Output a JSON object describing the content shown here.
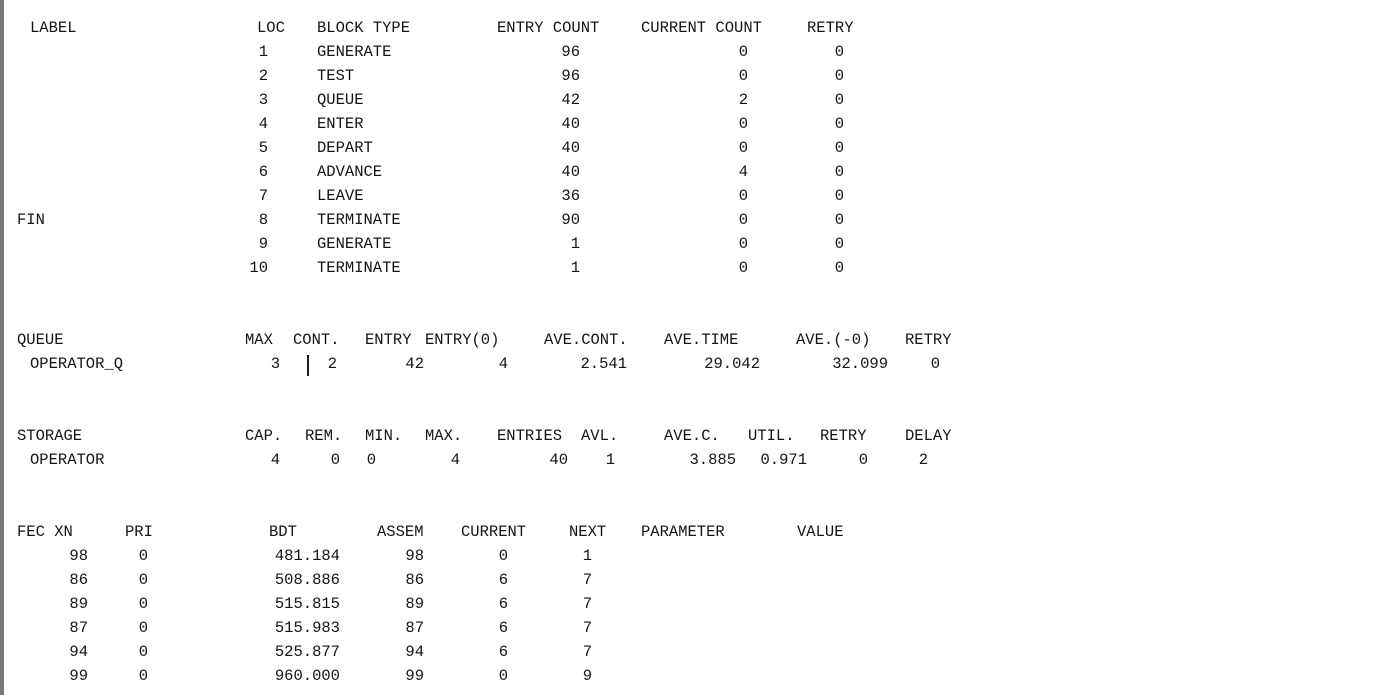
{
  "blocks": {
    "headers": {
      "label": "LABEL",
      "loc": "LOC",
      "block_type": "BLOCK TYPE",
      "entry_count": "ENTRY COUNT",
      "current_count": "CURRENT COUNT",
      "retry": "RETRY"
    },
    "rows": [
      {
        "label": "",
        "loc": "1",
        "block_type": "GENERATE",
        "entry_count": "96",
        "current_count": "0",
        "retry": "0"
      },
      {
        "label": "",
        "loc": "2",
        "block_type": "TEST",
        "entry_count": "96",
        "current_count": "0",
        "retry": "0"
      },
      {
        "label": "",
        "loc": "3",
        "block_type": "QUEUE",
        "entry_count": "42",
        "current_count": "2",
        "retry": "0"
      },
      {
        "label": "",
        "loc": "4",
        "block_type": "ENTER",
        "entry_count": "40",
        "current_count": "0",
        "retry": "0"
      },
      {
        "label": "",
        "loc": "5",
        "block_type": "DEPART",
        "entry_count": "40",
        "current_count": "0",
        "retry": "0"
      },
      {
        "label": "",
        "loc": "6",
        "block_type": "ADVANCE",
        "entry_count": "40",
        "current_count": "4",
        "retry": "0"
      },
      {
        "label": "",
        "loc": "7",
        "block_type": "LEAVE",
        "entry_count": "36",
        "current_count": "0",
        "retry": "0"
      },
      {
        "label": "FIN",
        "loc": "8",
        "block_type": "TERMINATE",
        "entry_count": "90",
        "current_count": "0",
        "retry": "0"
      },
      {
        "label": "",
        "loc": "9",
        "block_type": "GENERATE",
        "entry_count": "1",
        "current_count": "0",
        "retry": "0"
      },
      {
        "label": "",
        "loc": "10",
        "block_type": "TERMINATE",
        "entry_count": "1",
        "current_count": "0",
        "retry": "0"
      }
    ]
  },
  "queue": {
    "headers": {
      "name": "QUEUE",
      "max": "MAX",
      "cont": "CONT.",
      "entry": "ENTRY",
      "entry0": "ENTRY(0)",
      "ave_cont": "AVE.CONT.",
      "ave_time": "AVE.TIME",
      "ave_minus0": "AVE.(-0)",
      "retry": "RETRY"
    },
    "rows": [
      {
        "name": "OPERATOR_Q",
        "max": "3",
        "cont": "2",
        "entry": "42",
        "entry0": "4",
        "ave_cont": "2.541",
        "ave_time": "29.042",
        "ave_minus0": "32.099",
        "retry": "0"
      }
    ]
  },
  "storage": {
    "headers": {
      "name": "STORAGE",
      "cap": "CAP.",
      "rem": "REM.",
      "min": "MIN.",
      "max": "MAX.",
      "entries": "ENTRIES",
      "avl": "AVL.",
      "ave_c": "AVE.C.",
      "util": "UTIL.",
      "retry": "RETRY",
      "delay": "DELAY"
    },
    "rows": [
      {
        "name": "OPERATOR",
        "cap": "4",
        "rem": "0",
        "min": "0",
        "max": "4",
        "entries": "40",
        "avl": "1",
        "ave_c": "3.885",
        "util": "0.971",
        "retry": "0",
        "delay": "2"
      }
    ]
  },
  "fec": {
    "headers": {
      "xn": "FEC XN",
      "pri": "PRI",
      "bdt": "BDT",
      "assem": "ASSEM",
      "current": "CURRENT",
      "next": "NEXT",
      "parameter": "PARAMETER",
      "value": "VALUE"
    },
    "rows": [
      {
        "xn": "98",
        "pri": "0",
        "bdt": "481.184",
        "assem": "98",
        "current": "0",
        "next": "1"
      },
      {
        "xn": "86",
        "pri": "0",
        "bdt": "508.886",
        "assem": "86",
        "current": "6",
        "next": "7"
      },
      {
        "xn": "89",
        "pri": "0",
        "bdt": "515.815",
        "assem": "89",
        "current": "6",
        "next": "7"
      },
      {
        "xn": "87",
        "pri": "0",
        "bdt": "515.983",
        "assem": "87",
        "current": "6",
        "next": "7"
      },
      {
        "xn": "94",
        "pri": "0",
        "bdt": "525.877",
        "assem": "94",
        "current": "6",
        "next": "7"
      },
      {
        "xn": "99",
        "pri": "0",
        "bdt": "960.000",
        "assem": "99",
        "current": "0",
        "next": "9"
      }
    ]
  }
}
